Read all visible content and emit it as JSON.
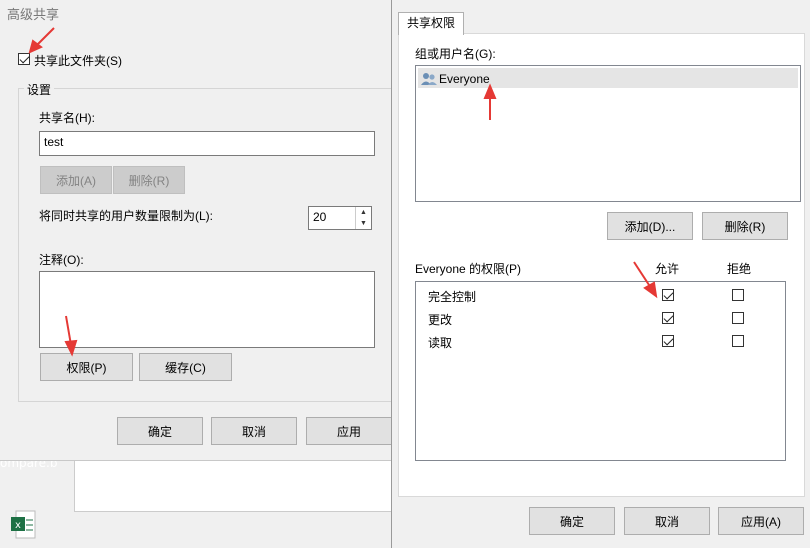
{
  "left_dialog": {
    "title": "高级共享",
    "share_checkbox": {
      "label": "共享此文件夹(S)",
      "checked": true
    },
    "settings_legend": "设置",
    "share_name_label": "共享名(H):",
    "share_name_value": "test",
    "add_button": "添加(A)",
    "delete_button": "删除(R)",
    "user_limit_label": "将同时共享的用户数量限制为(L):",
    "user_limit_value": "20",
    "comment_label": "注释(O):",
    "comment_value": "",
    "permissions_button": "权限(P)",
    "cache_button": "缓存(C)",
    "ok_button": "确定",
    "cancel_button": "取消",
    "apply_button": "应用"
  },
  "right_dialog": {
    "tab_label": "共享权限",
    "group_label": "组或用户名(G):",
    "users": [
      {
        "name": "Everyone",
        "icon": "users-icon"
      }
    ],
    "add_button": "添加(D)...",
    "remove_button": "删除(R)",
    "permissions_header": "Everyone 的权限(P)",
    "allow_header": "允许",
    "deny_header": "拒绝",
    "permissions": [
      {
        "name": "完全控制",
        "allow": true,
        "deny": false
      },
      {
        "name": "更改",
        "allow": true,
        "deny": false
      },
      {
        "name": "读取",
        "allow": true,
        "deny": false
      }
    ],
    "ok_button": "确定",
    "cancel_button": "取消",
    "apply_button": "应用(A)"
  },
  "background": {
    "partial_text": "ompare.b"
  },
  "colors": {
    "annotation_arrow": "#e53935",
    "selected_row": "#e5e5e5"
  }
}
